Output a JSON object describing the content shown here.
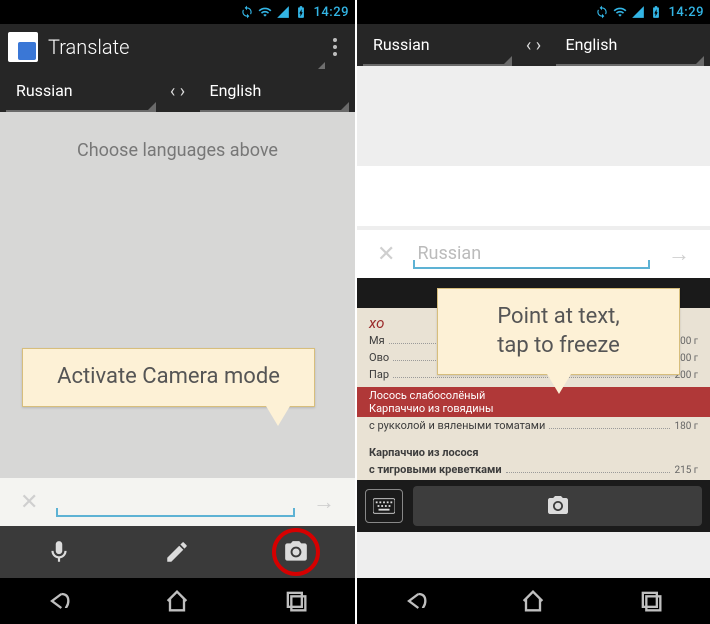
{
  "status": {
    "time": "14:29"
  },
  "left": {
    "app_title": "Translate",
    "lang_from": "Russian",
    "lang_to": "English",
    "hint": "Choose languages above",
    "tooltip": "Activate Camera mode"
  },
  "right": {
    "lang_from": "Russian",
    "lang_to": "English",
    "input_placeholder": "Russian",
    "tooltip_line1": "Point at text,",
    "tooltip_line2": "tap to freeze",
    "menu": {
      "heading_fragment": "хо",
      "lines": [
        {
          "name": "Мя",
          "grams": "200 г"
        },
        {
          "name": "Ово",
          "grams": "200 г"
        },
        {
          "name": "Пар",
          "grams": "200 г"
        }
      ],
      "red1": "Лосось слабосолёный",
      "red2": "Карпаччио из говядины",
      "sub": "с рукколой и вялеными томатами",
      "sub_grams": "180 г",
      "after1": "Карпаччио из лосося",
      "after2": "с тигровыми креветками",
      "after_grams": "215 г"
    }
  }
}
